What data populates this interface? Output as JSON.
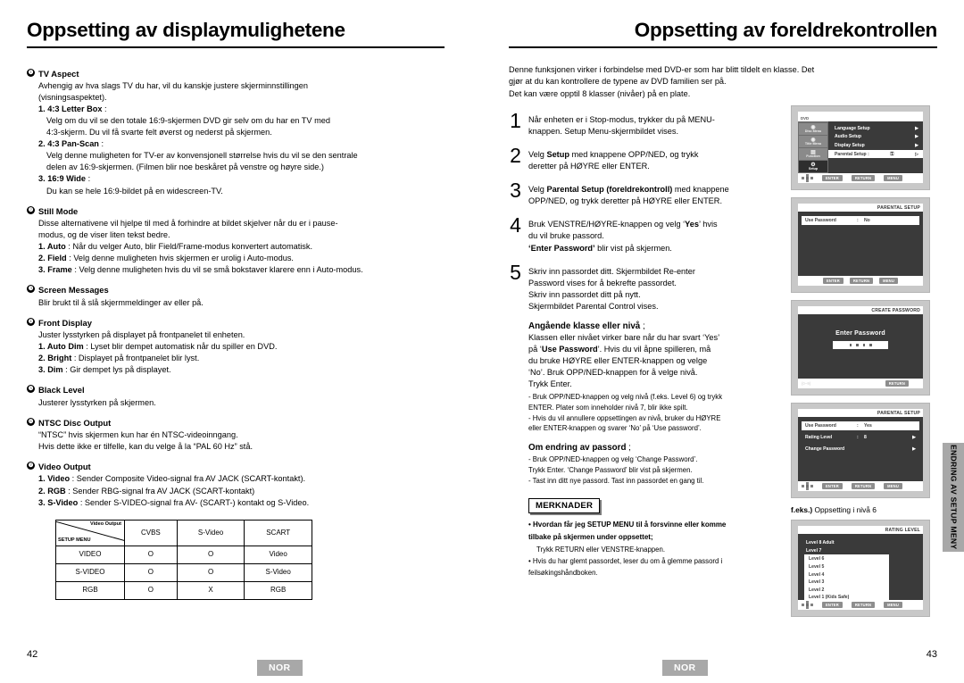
{
  "left_page": {
    "title": "Oppsetting av displaymulighetene",
    "page_number": "42",
    "region_badge": "NOR",
    "items": [
      {
        "num": "❶",
        "heading": "TV Aspect",
        "intro_1": "Avhengig av hva slags TV du har, vil du kanskje justere skjerminnstillingen",
        "intro_2": "(visningsaspektet).",
        "subs": [
          {
            "label": "1. 4:3 Letter Box",
            "sep": " :",
            "lines": [
              "Velg om du vil se den totale 16:9-skjermen DVD gir selv om du har en TV med",
              "4:3-skjerm. Du vil få svarte felt øverst og nederst på skjermen."
            ]
          },
          {
            "label": "2. 4:3 Pan-Scan",
            "sep": " :",
            "lines": [
              "Velg denne muligheten for TV-er av konvensjonell størrelse hvis du vil se den sentrale",
              "delen av 16:9-skjermen. (Filmen blir noe beskåret på venstre og høyre side.)"
            ]
          },
          {
            "label": "3. 16:9 Wide",
            "sep": " :",
            "lines": [
              "Du kan se hele 16:9-bildet på en widescreen-TV."
            ]
          }
        ]
      },
      {
        "num": "❷",
        "heading": "Still Mode",
        "intro_1": "Disse alternativene vil hjelpe til med å forhindre at bildet skjelver når du er i pause-",
        "intro_2": "modus, og de viser liten tekst bedre.",
        "inline_subs": [
          {
            "label": "1. Auto",
            "text": " : Når du velger Auto, blir Field/Frame-modus konvertert automatisk."
          },
          {
            "label": "2. Field",
            "text": " : Velg denne muligheten hvis skjermen er urolig i Auto-modus."
          },
          {
            "label": "3. Frame",
            "text": " : Velg denne muligheten hvis du vil se små bokstaver klarere enn i Auto-modus."
          }
        ]
      },
      {
        "num": "❸",
        "heading": "Screen Messages",
        "intro_1": "Blir brukt til å slå skjermmeldinger av eller på.",
        "intro_2": ""
      },
      {
        "num": "❹",
        "heading": "Front Display",
        "intro_1": "Juster lysstyrken på displayet på frontpanelet til enheten.",
        "intro_2": "",
        "inline_subs": [
          {
            "label": "1. Auto Dim",
            "text": " :  Lyset blir dempet automatisk når du spiller en DVD."
          },
          {
            "label": "2. Bright",
            "text": " : Displayet på frontpanelet blir lyst."
          },
          {
            "label": "3. Dim",
            "text": " : Gir dempet lys på displayet."
          }
        ]
      },
      {
        "num": "❺",
        "heading": "Black Level",
        "intro_1": "Justerer lysstyrken på skjermen.",
        "intro_2": ""
      },
      {
        "num": "❻",
        "heading": "NTSC Disc Output",
        "intro_1": "“NTSC” hvis skjermen kun har én NTSC-videoinngang.",
        "intro_2": "Hvis dette ikke er tilfelle, kan du velge å la “PAL 60 Hz” stå."
      },
      {
        "num": "❼",
        "heading": "Video Output",
        "intro_1": "",
        "intro_2": "",
        "inline_subs": [
          {
            "label": "1. Video",
            "text": " : Sender Composite Video-signal fra AV JACK (SCART-kontakt)."
          },
          {
            "label": "2. RGB",
            "text": " : Sender RBG-signal fra AV JACK (SCART-kontakt)"
          },
          {
            "label": "3. S-Video",
            "text": " : Sender S-VIDEO-signal fra AV- (SCART-) kontakt og S-Video."
          }
        ]
      }
    ],
    "video_table": {
      "corner_top": "Video Output",
      "corner_bottom": "SETUP MENU",
      "columns": [
        "CVBS",
        "S-Video",
        "SCART"
      ],
      "rows": [
        {
          "label": "VIDEO",
          "cells": [
            "O",
            "O",
            "Video"
          ]
        },
        {
          "label": "S-VIDEO",
          "cells": [
            "O",
            "O",
            "S-Video"
          ]
        },
        {
          "label": "RGB",
          "cells": [
            "O",
            "X",
            "RGB"
          ]
        }
      ]
    }
  },
  "right_page": {
    "title": "Oppsetting av foreldrekontrollen",
    "page_number": "43",
    "region_badge": "NOR",
    "intro": [
      "Denne funksjonen virker i forbindelse med DVD-er som har blitt tildelt en klasse. Det",
      "gjør at du kan kontrollere de typene av DVD familien ser på.",
      "Det kan være opptil 8 klasser (nivåer) på en plate."
    ],
    "steps": [
      {
        "num": "1",
        "lines": [
          [
            {
              "t": "Når enheten er i Stop-modus, trykker du på MENU-"
            }
          ],
          [
            {
              "t": "knappen. Setup Menu-skjermbildet vises."
            }
          ]
        ]
      },
      {
        "num": "2",
        "lines": [
          [
            {
              "t": "Velg "
            },
            {
              "t": "Setup",
              "b": true
            },
            {
              "t": " med knappene OPP/NED, og trykk"
            }
          ],
          [
            {
              "t": "deretter på HØYRE eller ENTER."
            }
          ]
        ]
      },
      {
        "num": "3",
        "lines": [
          [
            {
              "t": "Velg "
            },
            {
              "t": "Parental Setup (foreldrekontroll)",
              "b": true
            },
            {
              "t": " med knappene"
            }
          ],
          [
            {
              "t": "OPP/NED, og trykk deretter på HØYRE eller ENTER."
            }
          ]
        ]
      },
      {
        "num": "4",
        "lines": [
          [
            {
              "t": "Bruk VENSTRE/HØYRE-knappen og velg ‘"
            },
            {
              "t": "Yes",
              "b": true
            },
            {
              "t": "’ hvis"
            }
          ],
          [
            {
              "t": "du vil bruke passord."
            }
          ],
          [
            {
              "t": "‘",
              "b": true
            },
            {
              "t": "Enter Password",
              "b": true
            },
            {
              "t": "’",
              "b": true
            },
            {
              "t": " blir vist på skjermen."
            }
          ]
        ]
      },
      {
        "num": "5",
        "lines": [
          [
            {
              "t": "Skriv inn passordet ditt. Skjermbildet Re-enter"
            }
          ],
          [
            {
              "t": "Password vises for å bekrefte passordet."
            }
          ],
          [
            {
              "t": "Skriv inn passordet ditt på nytt."
            }
          ],
          [
            {
              "t": "Skjermbildet Parental Control vises."
            }
          ]
        ]
      }
    ],
    "level_section": {
      "heading": "Angående klasse eller nivå",
      "heading_suffix": " ;",
      "lines": [
        [
          {
            "t": "Klassen eller nivået virker bare når du har svart ‘Yes’"
          }
        ],
        [
          {
            "t": "på ‘"
          },
          {
            "t": "Use Password",
            "b": true
          },
          {
            "t": "’. Hvis du vil åpne spilleren, må"
          }
        ],
        [
          {
            "t": "du bruke HØYRE eller ENTER-knappen og velge"
          }
        ],
        [
          {
            "t": "‘No’. Bruk OPP/NED-knappen for å velge nivå."
          }
        ],
        [
          {
            "t": "Trykk Enter."
          }
        ]
      ],
      "bullets": [
        "- Bruk OPP/NED-knappen og velg nivå (f.eks. Level 6) og trykk",
        "  ENTER. Plater som inneholder nivå 7, blir ikke spilt.",
        "- Hvis du vil annullere oppsettingen av nivå, bruker du HØYRE",
        "  eller ENTER-knappen og svarer ‘No’ på ‘Use password’."
      ]
    },
    "password_section": {
      "heading": "Om endring av passord",
      "heading_suffix": " ;",
      "bullets": [
        "- Bruk OPP/NED-knappen og velg ‘Change Password’.",
        "  Trykk Enter. ‘Change Password’ blir vist på skjermen.",
        "- Tast inn ditt nye passord. Tast inn passordet en gang til."
      ]
    },
    "notes": {
      "badge": "MERKNADER",
      "items": [
        {
          "bold_lines": [
            "• Hvordan får jeg SETUP MENU til å forsvinne eller komme",
            "  tilbake på skjermen under oppsettet;"
          ],
          "plain_lines": [
            "Trykk RETURN eller VENSTRE-knappen."
          ]
        },
        {
          "bold_lines": [],
          "plain_lines": [
            "• Hvis du har glemt passordet, leser du om å glemme passord i",
            "  feilsøkingshåndboken."
          ]
        }
      ]
    },
    "side_tab": "ENDRING AV\nSETUP MENY",
    "screenshot_caption": {
      "bold": "f.eks.)",
      "text": " Oppsetting i nivå 6"
    }
  },
  "osd_screens": [
    {
      "name": "setup-menu",
      "disc_label": "DVD",
      "side_icons": [
        {
          "label": "Disc Menu",
          "glyph": "◉",
          "active": false
        },
        {
          "label": "Title Menu",
          "glyph": "◉",
          "active": false
        },
        {
          "label": "Function",
          "glyph": "▤",
          "active": false
        },
        {
          "label": "Setup",
          "glyph": "⚙",
          "active": true
        }
      ],
      "rows": [
        {
          "label": "Language Setup",
          "arrow": "▶",
          "selected": false
        },
        {
          "label": "Audio Setup",
          "arrow": "▶",
          "selected": false
        },
        {
          "label": "Display Setup",
          "arrow": "▶",
          "selected": false
        },
        {
          "label": "Parental Setup :",
          "arrow": "▷",
          "selected": true,
          "extra": "⚿"
        }
      ],
      "footer_keys": [
        "ENTER",
        "RETURN",
        "MENU"
      ]
    },
    {
      "name": "parental-setup-no",
      "title": "PARENTAL SETUP",
      "rows": [
        {
          "label": "Use Password",
          "colon": ":",
          "value": "No",
          "highlight": true,
          "arrow": ""
        }
      ],
      "footer_keys": [
        "ENTER",
        "RETURN",
        "MENU"
      ]
    },
    {
      "name": "create-password",
      "title": "CREATE PASSWORD",
      "center_title": "Enter Password",
      "digits": 4,
      "range_label": "(0~9)",
      "footer_keys": [
        "RETURN"
      ]
    },
    {
      "name": "parental-setup-yes",
      "title": "PARENTAL SETUP",
      "rows": [
        {
          "label": "Use Password",
          "colon": ":",
          "value": "Yes",
          "highlight": true,
          "arrow": ""
        },
        {
          "label": "Rating Level",
          "colon": ":",
          "value": "8",
          "highlight": false,
          "arrow": "▶"
        },
        {
          "label": "Change Password",
          "colon": "",
          "value": "",
          "highlight": false,
          "arrow": "▶"
        }
      ],
      "footer_keys": [
        "ENTER",
        "RETURN",
        "MENU"
      ]
    },
    {
      "name": "rating-level",
      "title": "RATING LEVEL",
      "levels_outside": [
        "Level 8 Adult",
        "Level 7"
      ],
      "levels_boxed": [
        "Level 6",
        "Level 5",
        "Level 4",
        "Level 3",
        "Level 2",
        "Level 1 (Kids Safe)"
      ],
      "footer_keys": [
        "ENTER",
        "RETURN",
        "MENU"
      ]
    }
  ]
}
